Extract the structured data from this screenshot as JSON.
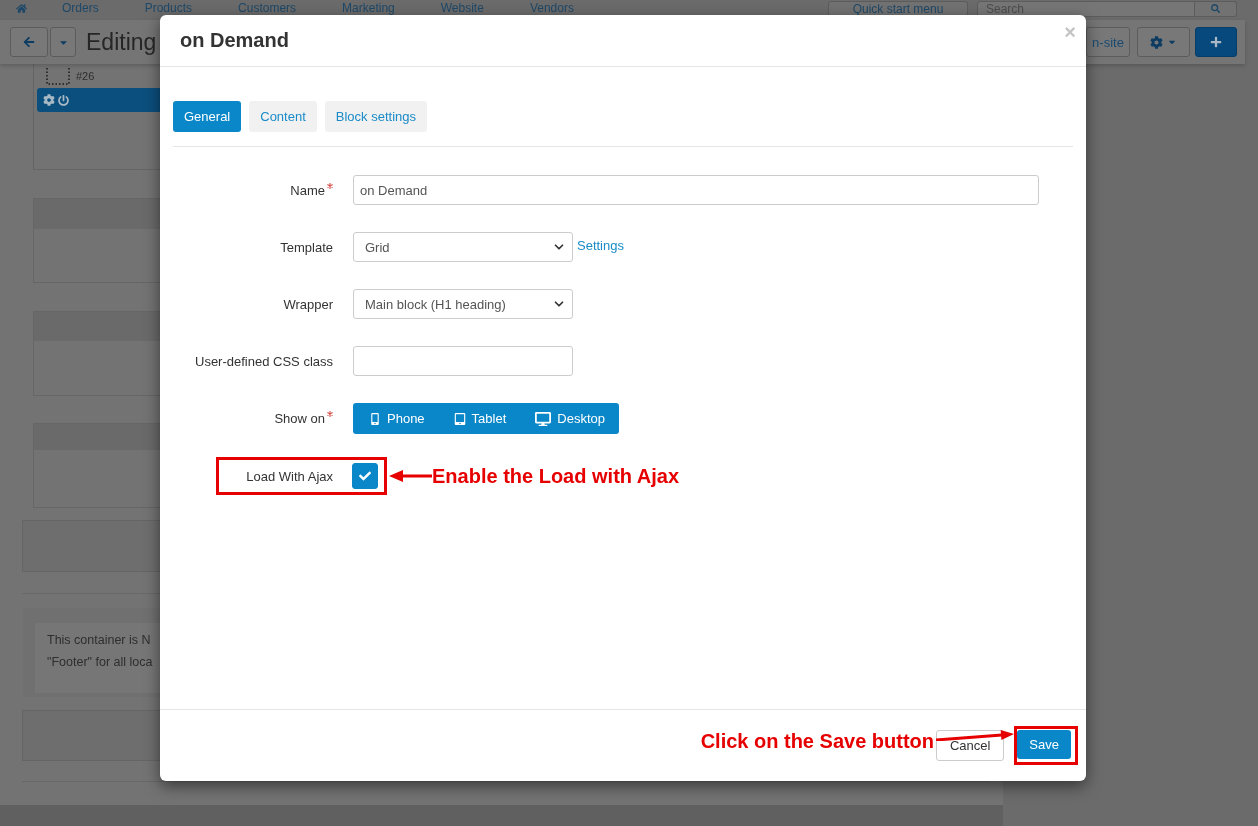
{
  "top_nav": {
    "items": [
      "Orders",
      "Products",
      "Customers",
      "Marketing",
      "Website",
      "Vendors"
    ],
    "quick_start_button": "Quick start menu",
    "search": {
      "placeholder": "Search"
    }
  },
  "toolbar": {
    "title": "Editing",
    "preview_button": "n-site"
  },
  "page": {
    "block_id": "#26",
    "container_note": [
      "This container is N",
      "\"Footer\" for all loca"
    ]
  },
  "dialog": {
    "title": "on Demand",
    "close": "×",
    "tabs": [
      {
        "label": "General",
        "selected": true
      },
      {
        "label": "Content",
        "selected": false
      },
      {
        "label": "Block settings",
        "selected": false
      }
    ],
    "fields": [
      {
        "kind": "wide",
        "label": "Name",
        "required": true,
        "highlighted": false,
        "value": "on Demand"
      },
      {
        "kind": "select",
        "label": "Template",
        "required": false,
        "highlighted": false,
        "value": "Grid",
        "link": "Settings"
      },
      {
        "kind": "select",
        "label": "Wrapper",
        "required": false,
        "highlighted": false,
        "value": "Main block (H1 heading)"
      },
      {
        "kind": "text",
        "label": "User-defined CSS class",
        "required": false,
        "highlighted": false
      },
      {
        "kind": "toggles",
        "label": "Show on",
        "required": true,
        "highlighted": false,
        "options": [
          {
            "label": "Phone",
            "selected": true
          },
          {
            "label": "Tablet",
            "selected": true
          },
          {
            "label": "Desktop",
            "selected": true
          }
        ]
      },
      {
        "kind": "checkbox",
        "label": "Load With Ajax",
        "required": false,
        "highlighted": true,
        "checked": true,
        "callout": "Enable the Load with Ajax"
      }
    ],
    "buttons": [
      {
        "kind": "dismiss",
        "label": "Cancel",
        "highlighted": false
      },
      {
        "kind": "submit",
        "label": "Save",
        "highlighted": true,
        "callout": "Click on the Save button"
      }
    ]
  }
}
